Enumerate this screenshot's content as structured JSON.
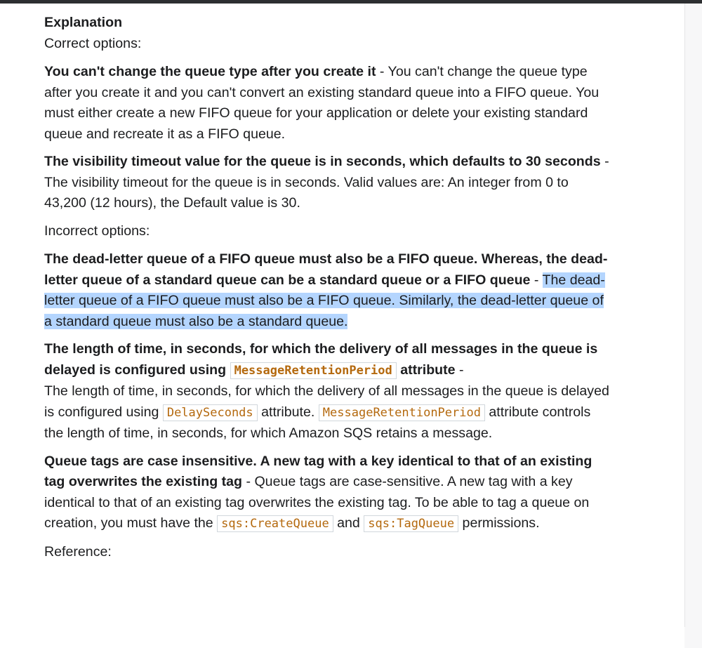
{
  "explanation": {
    "heading": "Explanation",
    "correct_label": "Correct options:",
    "incorrect_label": "Incorrect options:",
    "reference_label": "Reference:"
  },
  "correct_options": [
    {
      "title": "You can't change the queue type after you create it",
      "separator": " - ",
      "body": "You can't change the queue type after you create it and you can't convert an existing standard queue into a FIFO queue. You must either create a new FIFO queue for your application or delete your existing standard queue and recreate it as a FIFO queue."
    },
    {
      "title": "The visibility timeout value for the queue is in seconds, which defaults to 30 seconds",
      "separator": " - ",
      "body": "The visibility timeout for the queue is in seconds. Valid values are: An integer from 0 to 43,200 (12 hours), the Default value is 30."
    }
  ],
  "incorrect_options": [
    {
      "title": "The dead-letter queue of a FIFO queue must also be a FIFO queue. Whereas, the dead-letter queue of a standard queue can be a standard queue or a FIFO queue",
      "separator": " - ",
      "body_highlighted": "The dead-letter queue of a FIFO queue must also be a FIFO queue. Similarly, the dead-letter queue of a standard queue must also be a standard queue."
    },
    {
      "title_before_code": "The length of time, in seconds, for which the delivery of all messages in the queue is delayed is configured using ",
      "title_code": "MessageRetentionPeriod",
      "title_after_code": " attribute",
      "separator": " - ",
      "body_part1": "The length of time, in seconds, for which the delivery of all messages in the queue is delayed is configured using ",
      "body_code1": "DelaySeconds",
      "body_part2": " attribute. ",
      "body_code2": "MessageRetentionPeriod",
      "body_part3": " attribute controls the length of time, in seconds, for which Amazon SQS retains a message."
    },
    {
      "title": "Queue tags are case insensitive. A new tag with a key identical to that of an existing tag overwrites the existing tag",
      "separator": " - ",
      "body_part1": "Queue tags are case-sensitive. A new tag with a key identical to that of an existing tag overwrites the existing tag. To be able to tag a queue on creation, you must have the ",
      "body_code1": "sqs:CreateQueue",
      "body_part2": " and ",
      "body_code2": "sqs:TagQueue",
      "body_part3": " permissions."
    }
  ]
}
